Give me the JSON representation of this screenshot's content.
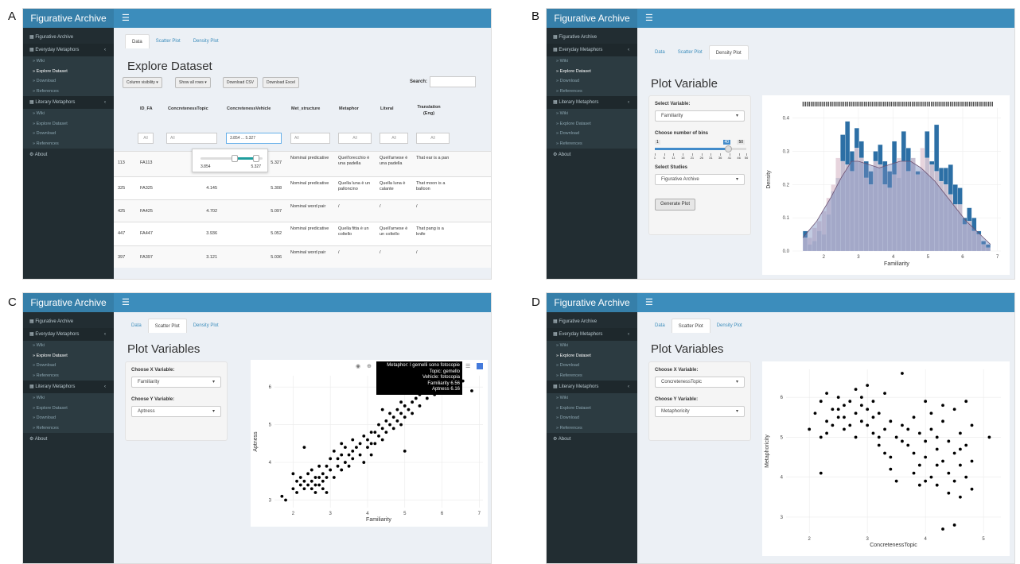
{
  "panel_labels": [
    "A",
    "B",
    "C",
    "D"
  ],
  "common": {
    "brand": "Figurative Archive",
    "sidebar": {
      "top": "Figurative Archive",
      "everyday": "Everyday Metaphors",
      "literary": "Literary Metaphors",
      "wiki": "Wiki",
      "explore": "Explore Dataset",
      "download": "Download",
      "references": "References",
      "about": "About"
    },
    "tabs": {
      "data": "Data",
      "scatter": "Scatter Plot",
      "density": "Density Plot"
    }
  },
  "panelA": {
    "title": "Explore Dataset",
    "buttons": {
      "colvis": "Column visibility",
      "showrows": "Show all rows",
      "csv": "Download CSV",
      "excel": "Download Excel"
    },
    "search_label": "Search:",
    "headers": [
      "ID_FA",
      "ConcretenessTopic",
      "ConcretenessVehicle",
      "Met_structure",
      "Metaphor",
      "Literal",
      "Translation (Eng)"
    ],
    "filters": {
      "all": "All",
      "vehicle": "3.854 ... 5.327"
    },
    "slider": {
      "min": "3.854",
      "max": "5.327",
      "low": 0.55,
      "high": 0.9
    },
    "rows": [
      {
        "n": "113",
        "id": "FA113",
        "ct": "",
        "cv": "5.327",
        "ms": "Nominal predicative",
        "met": "Quell'orecchio è una padella",
        "lit": "Quell'arnese è una padella",
        "tr": "That ear is a pan"
      },
      {
        "n": "325",
        "id": "FA325",
        "ct": "4.145",
        "cv": "5.308",
        "ms": "Nominal predicative",
        "met": "Quella luna è un palloncino",
        "lit": "Quella luna è calante",
        "tr": "That moon is a balloon"
      },
      {
        "n": "425",
        "id": "FA425",
        "ct": "4.702",
        "cv": "5.097",
        "ms": "Nominal word pair",
        "met": "/",
        "lit": "/",
        "tr": "/"
      },
      {
        "n": "447",
        "id": "FA447",
        "ct": "3.936",
        "cv": "5.052",
        "ms": "Nominal predicative",
        "met": "Quella fitta è un coltello",
        "lit": "Quell'arnese è un coltello",
        "tr": "That pang is a knife"
      },
      {
        "n": "397",
        "id": "FA397",
        "ct": "3.121",
        "cv": "5.036",
        "ms": "Nominal word pair",
        "met": "/",
        "lit": "/",
        "tr": "/"
      }
    ]
  },
  "panelB": {
    "title": "Plot Variable",
    "select_label": "Select Variable:",
    "select_value": "Familiarity",
    "bins_label": "Choose number of bins",
    "bins_min": "1",
    "bins_max": "50",
    "bins_value": "40",
    "bins_ticks": [
      "1",
      "6",
      "11",
      "16",
      "21",
      "26",
      "31",
      "36",
      "41",
      "46",
      "50"
    ],
    "studies_label": "Select Studies",
    "studies_value": "Figurative Archive",
    "button": "Generate Plot"
  },
  "panelC": {
    "title": "Plot Variables",
    "x_label": "Choose X Variable:",
    "x_value": "Familiarity",
    "y_label": "Choose Y Variable:",
    "y_value": "Aptness",
    "tooltip": [
      "Metaphor: I gemelli sono fotocopie",
      "Topic: gemello",
      "Vehicle: fotocopia",
      "Familiarity 6.56",
      "Aptness 6.16"
    ]
  },
  "panelD": {
    "title": "Plot Variables",
    "x_label": "Choose X Variable:",
    "x_value": "ConcretenessTopic",
    "y_label": "Choose Y Variable:",
    "y_value": "Metaphoricity"
  },
  "chart_data": [
    {
      "type": "bar",
      "panel": "B",
      "title": "",
      "xlabel": "Familiarity",
      "ylabel": "Density",
      "xlim": [
        1.1,
        7.1
      ],
      "ylim": [
        0,
        0.43
      ],
      "xticks": [
        2,
        3,
        4,
        5,
        6,
        7
      ],
      "yticks": [
        0.0,
        0.1,
        0.2,
        0.3,
        0.4
      ],
      "bin_start": 1.4,
      "bin_width": 0.135,
      "series": [
        {
          "name": "",
          "color": "#2c6fa5",
          "values": [
            0.06,
            0.02,
            0.03,
            0.06,
            0.05,
            0.11,
            0.18,
            0.22,
            0.35,
            0.39,
            0.3,
            0.37,
            0.33,
            0.27,
            0.24,
            0.3,
            0.32,
            0.27,
            0.24,
            0.33,
            0.22,
            0.36,
            0.31,
            0.28,
            0.24,
            0.24,
            0.36,
            0.27,
            0.38,
            0.25,
            0.25,
            0.26,
            0.2,
            0.19,
            0.1,
            0.13,
            0.1,
            0.06,
            0.03,
            0.02
          ]
        },
        {
          "name": "",
          "color": "#e3cdd8",
          "values": [
            0.04,
            0.04,
            0.07,
            0.09,
            0.12,
            0.16,
            0.2,
            0.28,
            0.27,
            0.26,
            0.24,
            0.31,
            0.28,
            0.22,
            0.2,
            0.27,
            0.26,
            0.2,
            0.19,
            0.23,
            0.28,
            0.27,
            0.24,
            0.28,
            0.23,
            0.31,
            0.28,
            0.26,
            0.24,
            0.21,
            0.2,
            0.17,
            0.14,
            0.14,
            0.08,
            0.09,
            0.06,
            0.05,
            0.02,
            0.01
          ]
        }
      ],
      "density": [
        [
          1.4,
          0.04
        ],
        [
          1.8,
          0.09
        ],
        [
          2.2,
          0.16
        ],
        [
          2.5,
          0.22
        ],
        [
          2.8,
          0.27
        ],
        [
          3.0,
          0.27
        ],
        [
          3.3,
          0.26
        ],
        [
          3.6,
          0.25
        ],
        [
          3.9,
          0.26
        ],
        [
          4.2,
          0.27
        ],
        [
          4.5,
          0.27
        ],
        [
          4.8,
          0.25
        ],
        [
          5.2,
          0.21
        ],
        [
          5.5,
          0.17
        ],
        [
          5.8,
          0.13
        ],
        [
          6.1,
          0.09
        ],
        [
          6.4,
          0.06
        ],
        [
          6.8,
          0.02
        ]
      ]
    },
    {
      "type": "scatter",
      "panel": "C",
      "title": "",
      "xlabel": "Familiarity",
      "ylabel": "Aptness",
      "xlim": [
        1.5,
        7.1
      ],
      "ylim": [
        2.8,
        6.3
      ],
      "xticks": [
        2,
        3,
        4,
        5,
        6,
        7
      ],
      "yticks": [
        3,
        4,
        5,
        6
      ],
      "points": [
        [
          1.7,
          3.1
        ],
        [
          1.8,
          3.0
        ],
        [
          2.0,
          3.3
        ],
        [
          2.1,
          3.5
        ],
        [
          2.1,
          3.2
        ],
        [
          2.2,
          3.4
        ],
        [
          2.2,
          3.6
        ],
        [
          2.3,
          3.5
        ],
        [
          2.3,
          3.3
        ],
        [
          2.4,
          3.7
        ],
        [
          2.4,
          3.4
        ],
        [
          2.5,
          3.3
        ],
        [
          2.5,
          3.5
        ],
        [
          2.5,
          3.8
        ],
        [
          2.6,
          3.6
        ],
        [
          2.6,
          3.4
        ],
        [
          2.6,
          3.2
        ],
        [
          2.7,
          3.4
        ],
        [
          2.7,
          3.6
        ],
        [
          2.7,
          3.9
        ],
        [
          2.8,
          3.7
        ],
        [
          2.8,
          3.5
        ],
        [
          2.8,
          3.3
        ],
        [
          2.9,
          3.9
        ],
        [
          2.9,
          3.6
        ],
        [
          3.0,
          3.8
        ],
        [
          3.0,
          4.1
        ],
        [
          3.1,
          3.6
        ],
        [
          3.1,
          4.3
        ],
        [
          3.2,
          3.9
        ],
        [
          3.2,
          4.1
        ],
        [
          3.3,
          4.2
        ],
        [
          3.3,
          3.8
        ],
        [
          3.4,
          4.0
        ],
        [
          3.4,
          4.4
        ],
        [
          3.5,
          4.2
        ],
        [
          3.5,
          3.9
        ],
        [
          3.6,
          4.6
        ],
        [
          3.6,
          4.3
        ],
        [
          3.7,
          4.4
        ],
        [
          3.8,
          4.5
        ],
        [
          3.8,
          4.2
        ],
        [
          3.9,
          4.0
        ],
        [
          3.9,
          4.7
        ],
        [
          4.0,
          4.4
        ],
        [
          4.0,
          4.6
        ],
        [
          4.1,
          4.5
        ],
        [
          4.1,
          4.2
        ],
        [
          4.2,
          4.8
        ],
        [
          4.2,
          4.5
        ],
        [
          4.3,
          4.7
        ],
        [
          4.3,
          5.0
        ],
        [
          4.4,
          4.6
        ],
        [
          4.4,
          4.9
        ],
        [
          4.5,
          5.1
        ],
        [
          4.5,
          4.8
        ],
        [
          4.6,
          5.0
        ],
        [
          4.6,
          5.3
        ],
        [
          4.7,
          5.2
        ],
        [
          4.7,
          4.9
        ],
        [
          4.8,
          5.4
        ],
        [
          4.8,
          5.1
        ],
        [
          4.9,
          5.3
        ],
        [
          4.9,
          5.6
        ],
        [
          5.0,
          5.2
        ],
        [
          5.0,
          5.5
        ],
        [
          5.0,
          4.3
        ],
        [
          5.1,
          5.4
        ],
        [
          5.2,
          5.6
        ],
        [
          5.2,
          5.3
        ],
        [
          5.3,
          5.7
        ],
        [
          5.4,
          5.5
        ],
        [
          5.4,
          5.8
        ],
        [
          5.5,
          5.9
        ],
        [
          5.6,
          5.7
        ],
        [
          5.7,
          6.0
        ],
        [
          5.8,
          5.8
        ],
        [
          5.9,
          6.1
        ],
        [
          6.1,
          6.0
        ],
        [
          6.3,
          6.1
        ],
        [
          6.56,
          6.16
        ],
        [
          6.8,
          5.9
        ],
        [
          2.0,
          3.7
        ],
        [
          2.3,
          4.4
        ],
        [
          3.3,
          4.5
        ],
        [
          2.9,
          3.2
        ],
        [
          4.1,
          4.8
        ],
        [
          4.4,
          5.4
        ],
        [
          3.6,
          4.1
        ],
        [
          4.9,
          5.0
        ]
      ]
    },
    {
      "type": "scatter",
      "panel": "D",
      "title": "",
      "xlabel": "ConcretenessTopic",
      "ylabel": "Metaphoricity",
      "xlim": [
        1.6,
        5.3
      ],
      "ylim": [
        2.6,
        6.7
      ],
      "xticks": [
        2,
        3,
        4,
        5
      ],
      "yticks": [
        3,
        4,
        5,
        6
      ],
      "points": [
        [
          2.0,
          5.2
        ],
        [
          2.1,
          5.6
        ],
        [
          2.2,
          5.0
        ],
        [
          2.2,
          5.9
        ],
        [
          2.3,
          5.4
        ],
        [
          2.3,
          6.1
        ],
        [
          2.4,
          5.7
        ],
        [
          2.4,
          5.3
        ],
        [
          2.5,
          5.5
        ],
        [
          2.5,
          6.0
        ],
        [
          2.6,
          5.2
        ],
        [
          2.6,
          5.8
        ],
        [
          2.6,
          5.5
        ],
        [
          2.7,
          5.9
        ],
        [
          2.7,
          5.3
        ],
        [
          2.8,
          5.6
        ],
        [
          2.8,
          6.2
        ],
        [
          2.8,
          5.0
        ],
        [
          2.9,
          5.8
        ],
        [
          2.9,
          5.4
        ],
        [
          2.9,
          6.0
        ],
        [
          3.0,
          5.3
        ],
        [
          3.0,
          5.7
        ],
        [
          3.0,
          6.3
        ],
        [
          3.1,
          5.1
        ],
        [
          3.1,
          5.9
        ],
        [
          3.1,
          5.5
        ],
        [
          3.2,
          4.8
        ],
        [
          3.2,
          5.6
        ],
        [
          3.3,
          5.2
        ],
        [
          3.3,
          6.1
        ],
        [
          3.3,
          4.6
        ],
        [
          3.4,
          5.4
        ],
        [
          3.4,
          4.2
        ],
        [
          3.5,
          5.0
        ],
        [
          3.5,
          3.9
        ],
        [
          3.6,
          6.6
        ],
        [
          3.6,
          5.3
        ],
        [
          3.7,
          5.2
        ],
        [
          3.7,
          4.8
        ],
        [
          3.8,
          4.6
        ],
        [
          3.8,
          5.5
        ],
        [
          3.9,
          4.3
        ],
        [
          3.9,
          5.1
        ],
        [
          3.9,
          3.8
        ],
        [
          4.0,
          5.9
        ],
        [
          4.0,
          4.9
        ],
        [
          4.0,
          4.5
        ],
        [
          4.1,
          5.2
        ],
        [
          4.1,
          4.0
        ],
        [
          4.1,
          5.6
        ],
        [
          4.2,
          4.7
        ],
        [
          4.2,
          3.8
        ],
        [
          4.2,
          5.0
        ],
        [
          4.3,
          5.8
        ],
        [
          4.3,
          4.4
        ],
        [
          4.3,
          5.4
        ],
        [
          4.4,
          4.1
        ],
        [
          4.4,
          4.9
        ],
        [
          4.4,
          3.6
        ],
        [
          4.5,
          5.7
        ],
        [
          4.5,
          4.6
        ],
        [
          4.5,
          3.9
        ],
        [
          4.6,
          5.1
        ],
        [
          4.6,
          4.3
        ],
        [
          4.6,
          3.5
        ],
        [
          4.7,
          4.8
        ],
        [
          4.7,
          4.0
        ],
        [
          4.7,
          5.9
        ],
        [
          4.8,
          4.4
        ],
        [
          4.8,
          3.7
        ],
        [
          4.8,
          5.3
        ],
        [
          5.1,
          5.0
        ],
        [
          4.5,
          2.8
        ],
        [
          4.3,
          2.7
        ],
        [
          2.2,
          4.1
        ],
        [
          2.3,
          5.1
        ],
        [
          2.5,
          5.7
        ],
        [
          3.2,
          5.0
        ],
        [
          3.6,
          4.9
        ],
        [
          3.8,
          4.1
        ],
        [
          4.0,
          3.9
        ],
        [
          4.6,
          4.7
        ],
        [
          4.2,
          4.3
        ],
        [
          3.4,
          4.5
        ]
      ]
    }
  ]
}
